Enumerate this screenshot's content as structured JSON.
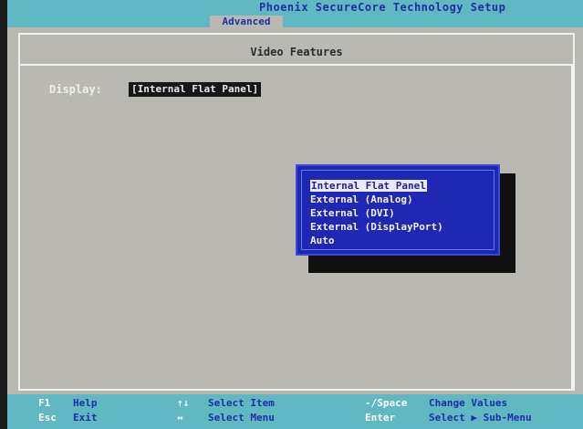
{
  "app": {
    "title": "Phoenix SecureCore Technology Setup"
  },
  "tabs": {
    "active": "Advanced"
  },
  "panel": {
    "title": "Video Features"
  },
  "display": {
    "label": "Display:",
    "value": "[Internal Flat Panel]"
  },
  "popup": {
    "options": [
      {
        "label": "Internal Flat Panel",
        "selected": true
      },
      {
        "label": "External (Analog)"
      },
      {
        "label": "External (DVI)"
      },
      {
        "label": "External (DisplayPort)"
      },
      {
        "label": "Auto"
      }
    ]
  },
  "status": {
    "f1": {
      "key": "F1",
      "label": "Help"
    },
    "esc": {
      "key": "Esc",
      "label": "Exit"
    },
    "arrows": {
      "key": "↑↓",
      "label": "Select Item"
    },
    "lr": {
      "key": "↔",
      "label": "Select Menu"
    },
    "space": {
      "key": "-/Space",
      "label": "Change Values"
    },
    "enter": {
      "key": "Enter",
      "label": "Select ▶ Sub-Menu"
    }
  },
  "colors": {
    "bar": "#5fb8c2",
    "screen": "#b9b8b2",
    "popup": "#1e28b4",
    "text_blue": "#1f2fa6"
  }
}
